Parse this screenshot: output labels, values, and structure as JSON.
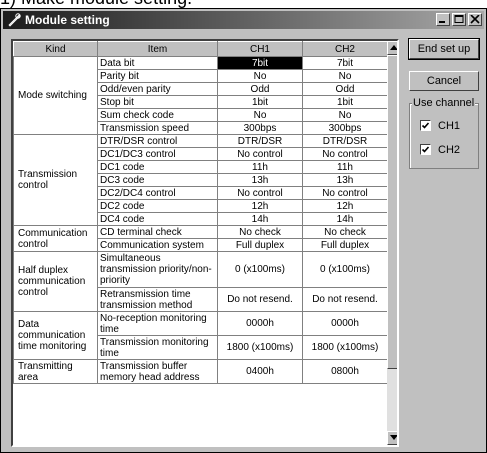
{
  "caption": "1) Make module setting.",
  "window": {
    "title": "Module setting",
    "controls": [
      "minimize-icon",
      "maximize-icon",
      "close-icon"
    ]
  },
  "table": {
    "headers": [
      "Kind",
      "Item",
      "CH1",
      "CH2"
    ],
    "selected_cell": "CH1 Data bit",
    "groups": [
      {
        "kind": "Mode switching",
        "rows": [
          {
            "item": "Data bit",
            "ch1": "7bit",
            "ch2": "7bit"
          },
          {
            "item": "Parity bit",
            "ch1": "No",
            "ch2": "No"
          },
          {
            "item": "Odd/even parity",
            "ch1": "Odd",
            "ch2": "Odd"
          },
          {
            "item": "Stop bit",
            "ch1": "1bit",
            "ch2": "1bit"
          },
          {
            "item": "Sum check code",
            "ch1": "No",
            "ch2": "No"
          },
          {
            "item": "Transmission speed",
            "ch1": "300bps",
            "ch2": "300bps"
          }
        ]
      },
      {
        "kind": "Transmission control",
        "rows": [
          {
            "item": "DTR/DSR control",
            "ch1": "DTR/DSR",
            "ch2": "DTR/DSR"
          },
          {
            "item": "DC1/DC3 control",
            "ch1": "No control",
            "ch2": "No control"
          },
          {
            "item": "DC1 code",
            "ch1": "11h",
            "ch2": "11h"
          },
          {
            "item": "DC3 code",
            "ch1": "13h",
            "ch2": "13h"
          },
          {
            "item": "DC2/DC4 control",
            "ch1": "No control",
            "ch2": "No control"
          },
          {
            "item": "DC2 code",
            "ch1": "12h",
            "ch2": "12h"
          },
          {
            "item": "DC4 code",
            "ch1": "14h",
            "ch2": "14h"
          }
        ]
      },
      {
        "kind": "Communication control",
        "rows": [
          {
            "item": "CD terminal check",
            "ch1": "No check",
            "ch2": "No check"
          },
          {
            "item": "Communication system",
            "ch1": "Full duplex",
            "ch2": "Full duplex"
          }
        ]
      },
      {
        "kind": "Half duplex communication control",
        "rows": [
          {
            "item": "Simultaneous transmission priority/non-priority",
            "ch1": "0 (x100ms)",
            "ch2": "0 (x100ms)"
          },
          {
            "item": "Retransmission time transmission method",
            "ch1": "Do not resend.",
            "ch2": "Do not resend."
          }
        ]
      },
      {
        "kind": "Data communication time monitoring",
        "rows": [
          {
            "item": "No-reception monitoring time",
            "ch1": "0000h",
            "ch2": "0000h"
          },
          {
            "item": "Transmission monitoring time",
            "ch1": "1800 (x100ms)",
            "ch2": "1800 (x100ms)"
          }
        ]
      },
      {
        "kind": "Transmitting area",
        "rows": [
          {
            "item": "Transmission buffer memory head address",
            "ch1": "0400h",
            "ch2": "0800h"
          }
        ]
      }
    ]
  },
  "buttons": {
    "end_setup": "End set up",
    "cancel": "Cancel"
  },
  "use_channel": {
    "legend": "Use channel",
    "options": [
      {
        "label": "CH1",
        "checked": true
      },
      {
        "label": "CH2",
        "checked": true
      }
    ]
  },
  "scrollbar": {
    "up_icon": "arrow-up-icon",
    "down_icon": "arrow-down-icon"
  }
}
